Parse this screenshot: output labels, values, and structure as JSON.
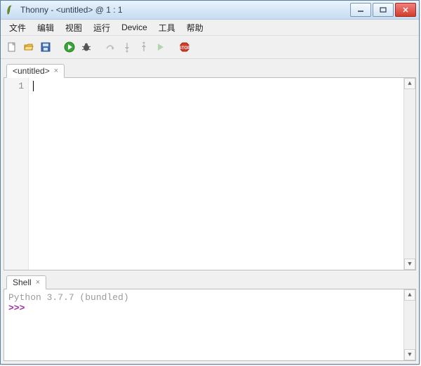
{
  "window": {
    "title": "Thonny  -  <untitled>  @  1 : 1"
  },
  "menu": {
    "file": "文件",
    "edit": "编辑",
    "view": "视图",
    "run": "运行",
    "device": "Device",
    "tools": "工具",
    "help": "帮助"
  },
  "toolbar": {
    "new": "new-file-icon",
    "open": "open-file-icon",
    "save": "save-icon",
    "run": "run-icon",
    "debug": "debug-icon",
    "step_over": "step-over-icon",
    "step_into": "step-into-icon",
    "step_out": "step-out-icon",
    "resume": "resume-icon",
    "stop": "stop-icon"
  },
  "editor": {
    "tab_label": "<untitled>",
    "line_numbers": [
      "1"
    ],
    "content": ""
  },
  "shell": {
    "tab_label": "Shell",
    "banner": "Python 3.7.7 (bundled)",
    "prompt": ">>> "
  }
}
